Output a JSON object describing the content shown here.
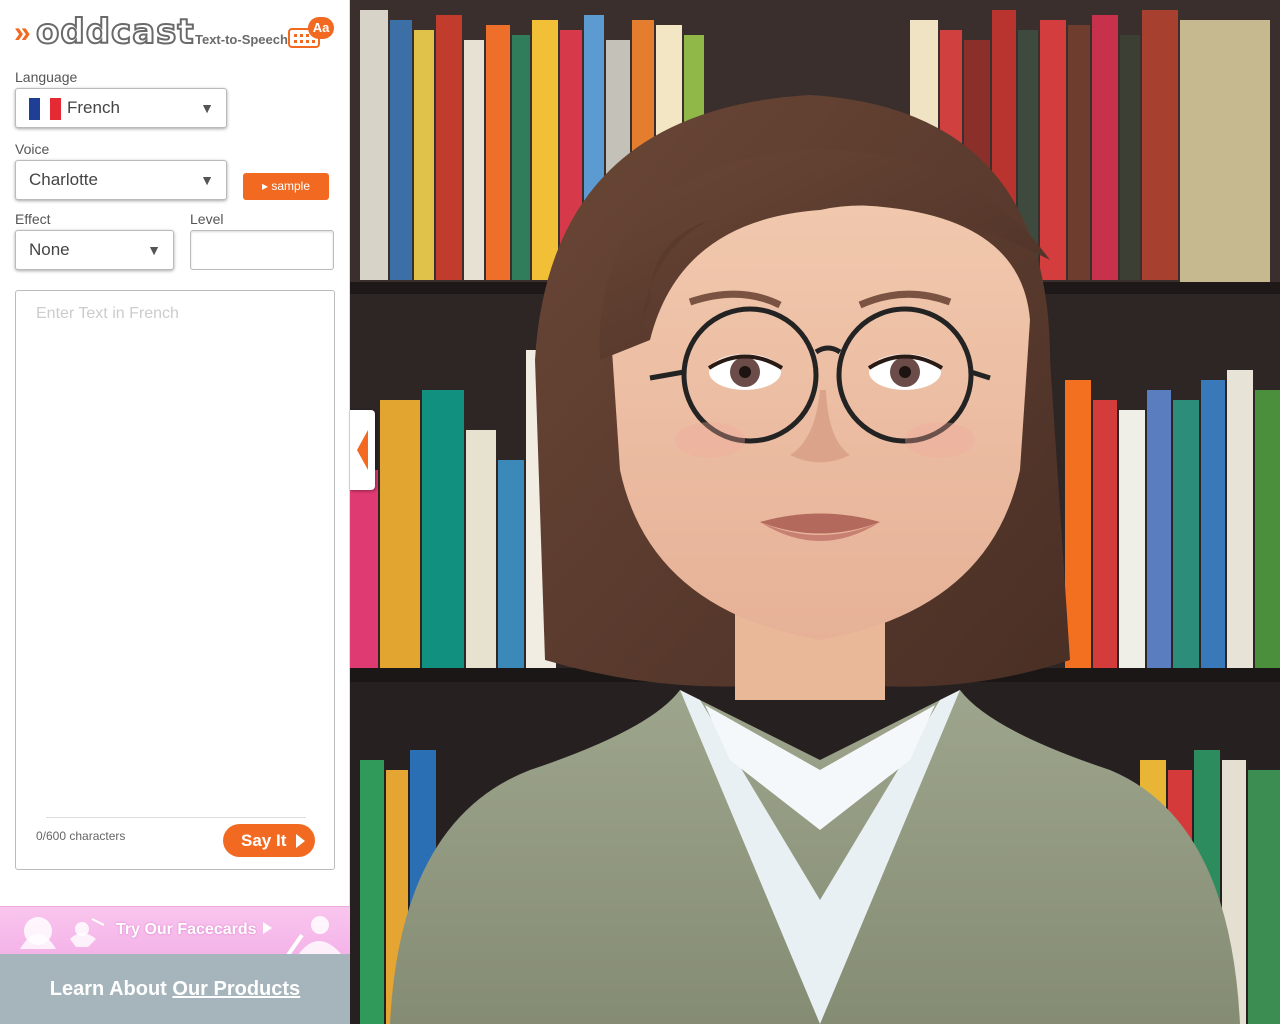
{
  "brand": {
    "logo_text": "oddcast",
    "product_label": "Text-to-Speech",
    "badge_text": "Aa",
    "accent_color": "#f26a21"
  },
  "language": {
    "label": "Language",
    "selected": "French",
    "flag": "france-flag"
  },
  "voice": {
    "label": "Voice",
    "selected": "Charlotte",
    "sample_button": "▸ sample"
  },
  "effect": {
    "label": "Effect",
    "selected": "None"
  },
  "level": {
    "label": "Level",
    "value": ""
  },
  "text_entry": {
    "placeholder": "Enter Text in French",
    "value": "",
    "char_count": "0/600 characters",
    "say_button": "Say It"
  },
  "promos": {
    "facecards_text": "Try Our Facecards",
    "learn_prefix": "Learn About",
    "learn_link": "Our Products"
  },
  "stage": {
    "character": "female-avatar",
    "background": "bookshelf"
  }
}
